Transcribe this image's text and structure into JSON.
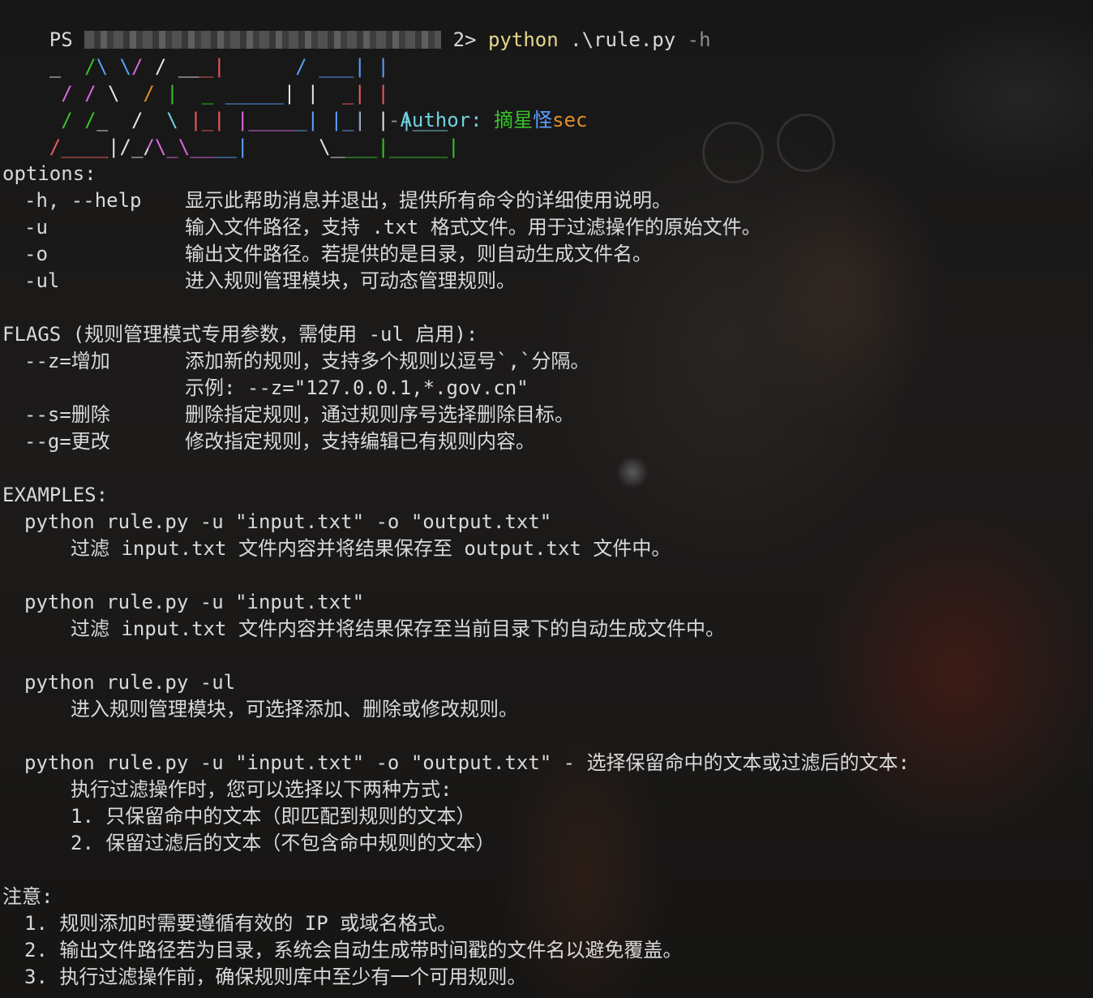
{
  "prompt": {
    "ps": "PS",
    "suffix": "2>",
    "command": "python",
    "args": ".\\rule.py",
    "flag": "-h"
  },
  "banner": {
    "lines": [
      "_  /\\ \\/ / ___|      / ___| |",
      " / / \\  / |  _ _____| |  _| |",
      " / /_  /  \\ |_| |_____| |_| | |___",
      "/____|/_/\\_\\____|      \\____|_____|"
    ],
    "author_prefix": "-",
    "author_label": "Author:",
    "author_name_1": "摘",
    "author_name_2": "星",
    "author_name_3": "怪",
    "author_name_4": "sec"
  },
  "options": {
    "heading": "options:",
    "items": [
      {
        "flag": "-h, --help",
        "desc": "显示此帮助消息并退出，提供所有命令的详细使用说明。"
      },
      {
        "flag": "-u",
        "desc": "输入文件路径，支持 .txt 格式文件。用于过滤操作的原始文件。"
      },
      {
        "flag": "-o",
        "desc": "输出文件路径。若提供的是目录，则自动生成文件名。"
      },
      {
        "flag": "-ul",
        "desc": "进入规则管理模块，可动态管理规则。"
      }
    ]
  },
  "flags": {
    "heading": "FLAGS (规则管理模式专用参数，需使用 -ul 启用):",
    "items": [
      {
        "flag": "--z=增加",
        "desc": "添加新的规则，支持多个规则以逗号`,`分隔。"
      },
      {
        "flag": "",
        "desc": "示例: --z=\"127.0.0.1,*.gov.cn\""
      },
      {
        "flag": "--s=删除",
        "desc": "删除指定规则，通过规则序号选择删除目标。"
      },
      {
        "flag": "--g=更改",
        "desc": "修改指定规则，支持编辑已有规则内容。"
      }
    ]
  },
  "examples": {
    "heading": "EXAMPLES:",
    "ex1_cmd": "python rule.py -u \"input.txt\" -o \"output.txt\"",
    "ex1_desc": "过滤 input.txt 文件内容并将结果保存至 output.txt 文件中。",
    "ex2_cmd": "python rule.py -u \"input.txt\"",
    "ex2_desc": "过滤 input.txt 文件内容并将结果保存至当前目录下的自动生成文件中。",
    "ex3_cmd": "python rule.py -ul",
    "ex3_desc": "进入规则管理模块，可选择添加、删除或修改规则。",
    "ex4_cmd": "python rule.py -u \"input.txt\" -o \"output.txt\" - 选择保留命中的文本或过滤后的文本:",
    "ex4_desc": "执行过滤操作时，您可以选择以下两种方式:",
    "ex4_opt1": "1. 只保留命中的文本（即匹配到规则的文本）",
    "ex4_opt2": "2. 保留过滤后的文本（不包含命中规则的文本）"
  },
  "notes": {
    "heading": "注意:",
    "items": [
      "1. 规则添加时需要遵循有效的 IP 或域名格式。",
      "2. 输出文件路径若为目录，系统会自动生成带时间戳的文件名以避免覆盖。",
      "3. 执行过滤操作前，确保规则库中至少有一个可用规则。"
    ]
  },
  "colors": {
    "background": "#141414",
    "text": "#d9d9d9",
    "command": "#e5d88b",
    "flag_dim": "#8e8e8e"
  }
}
